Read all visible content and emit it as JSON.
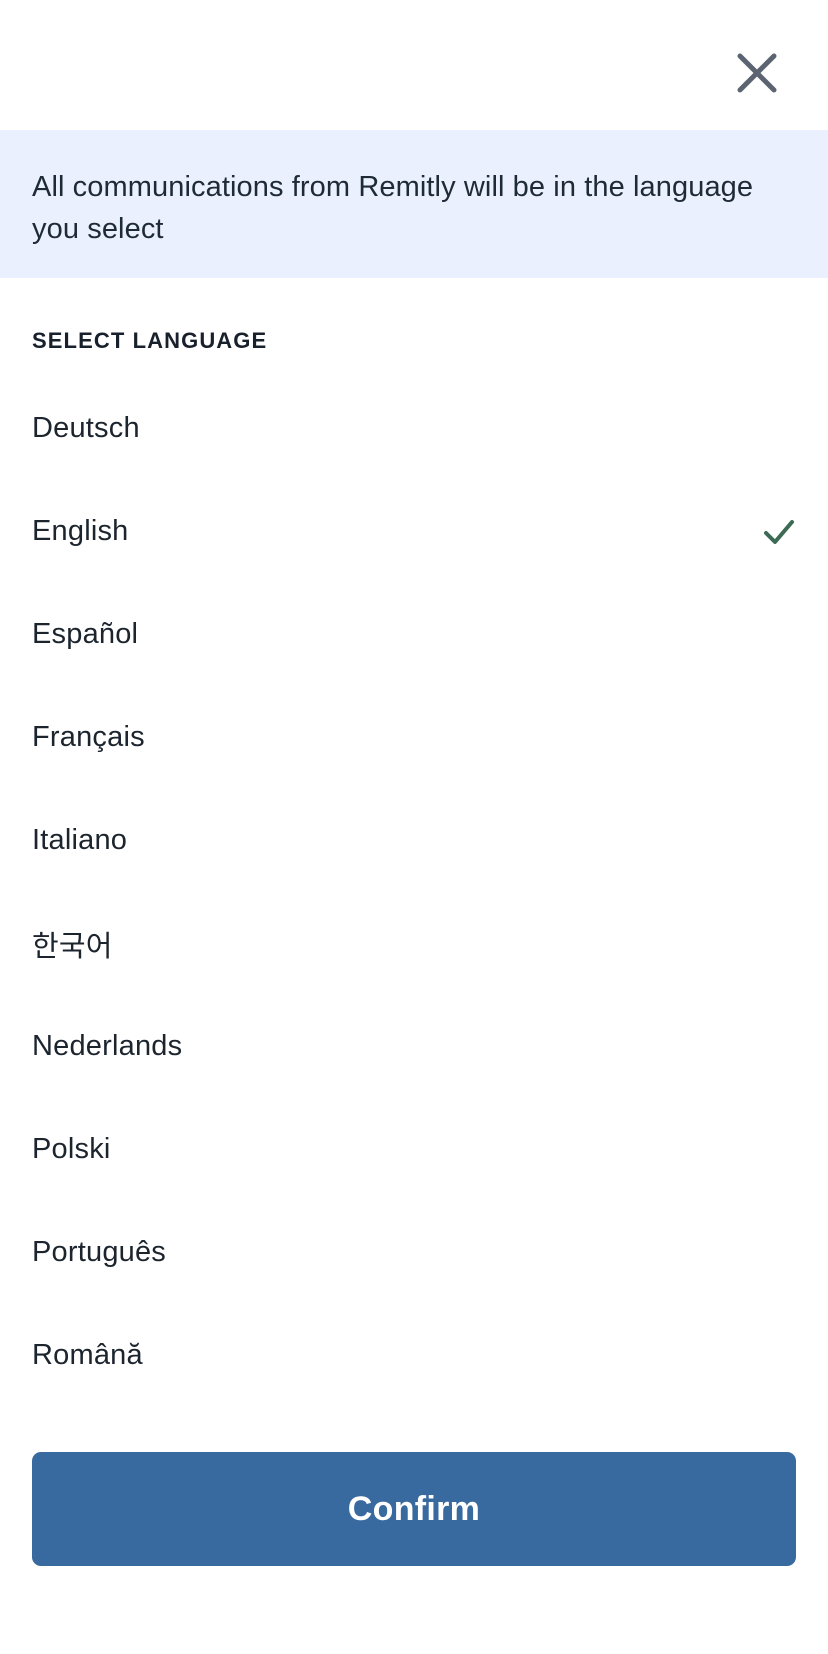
{
  "header": {
    "close_icon": "close-icon"
  },
  "banner": {
    "message": "All communications from Remitly will be in the language you select",
    "background_color": "#eaf0fd"
  },
  "list": {
    "section_label": "SELECT LANGUAGE",
    "selected_language": "English",
    "check_icon": "check-icon",
    "check_color": "#3b6b54",
    "items": [
      {
        "label": "Deutsch",
        "selected": false
      },
      {
        "label": "English",
        "selected": true
      },
      {
        "label": "Español",
        "selected": false
      },
      {
        "label": "Français",
        "selected": false
      },
      {
        "label": "Italiano",
        "selected": false
      },
      {
        "label": "한국어",
        "selected": false
      },
      {
        "label": "Nederlands",
        "selected": false
      },
      {
        "label": "Polski",
        "selected": false
      },
      {
        "label": "Português",
        "selected": false
      },
      {
        "label": "Română",
        "selected": false
      }
    ]
  },
  "footer": {
    "confirm_label": "Confirm",
    "confirm_color": "#38699f"
  }
}
